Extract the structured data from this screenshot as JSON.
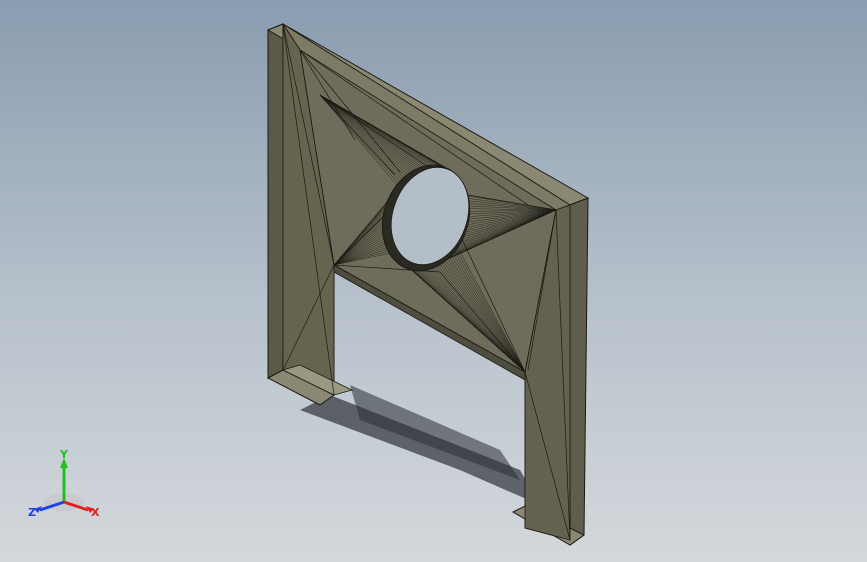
{
  "viewport": {
    "background_top": "#8a9cb0",
    "background_bottom": "#d4d8dc"
  },
  "model": {
    "face_color": "#6e6c5a",
    "edge_color": "#1a1a14",
    "shadow_color": "#30343a"
  },
  "triad": {
    "x_label": "X",
    "y_label": "Y",
    "z_label": "Z",
    "x_color": "#e02020",
    "y_color": "#20c020",
    "z_color": "#2040e0"
  }
}
